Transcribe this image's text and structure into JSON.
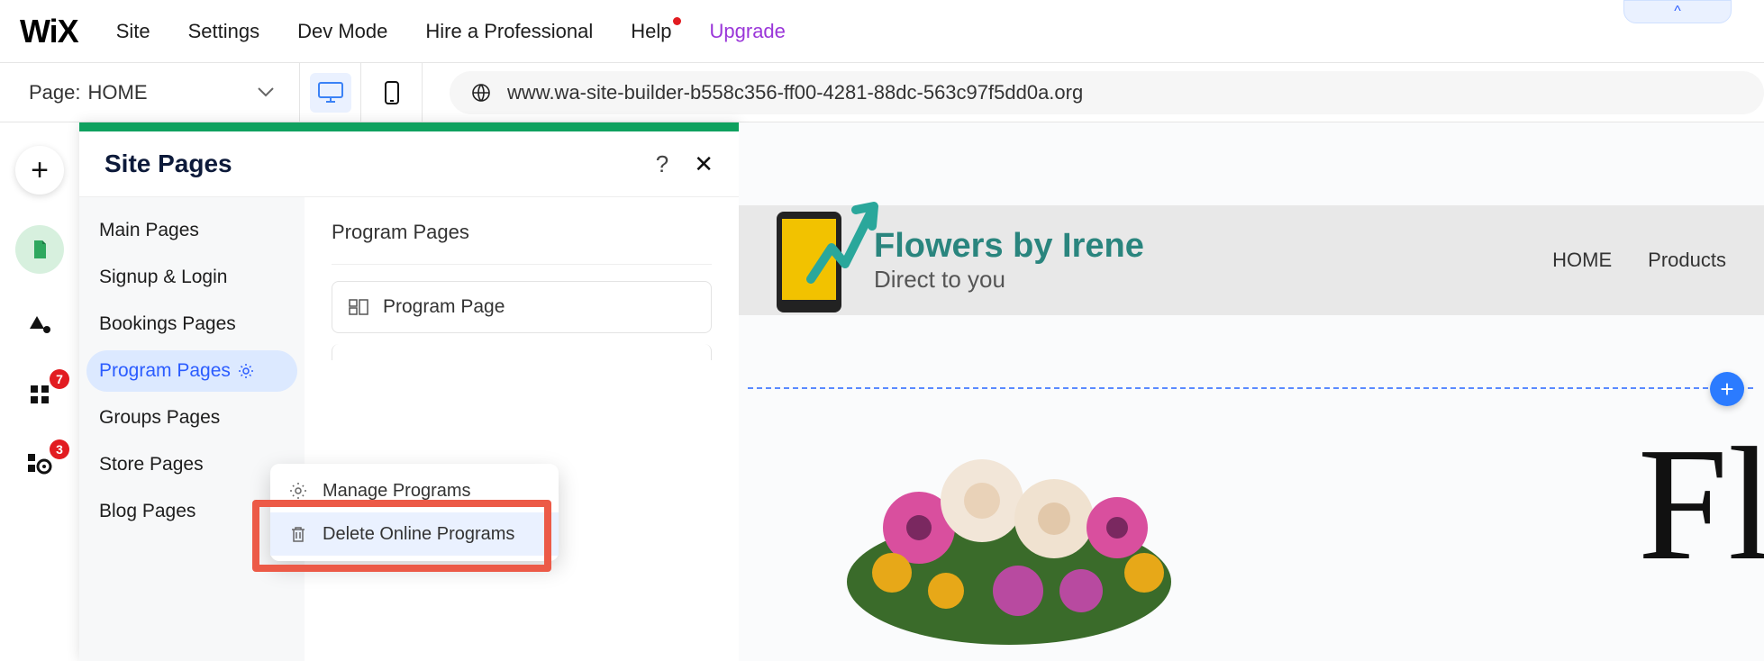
{
  "topMenu": {
    "site": "Site",
    "settings": "Settings",
    "devMode": "Dev Mode",
    "hire": "Hire a Professional",
    "help": "Help",
    "upgrade": "Upgrade"
  },
  "pageSelector": {
    "label": "Page:",
    "value": "HOME"
  },
  "url": "www.wa-site-builder-b558c356-ff00-4281-88dc-563c97f5dd0a.org",
  "collapseGlyph": "^",
  "leftTool": {
    "badge1": "7",
    "badge2": "3"
  },
  "panel": {
    "title": "Site Pages",
    "help": "?",
    "close": "✕",
    "categories": {
      "main": "Main Pages",
      "signup": "Signup & Login",
      "bookings": "Bookings Pages",
      "program": "Program Pages",
      "groups": "Groups Pages",
      "store": "Store Pages",
      "blog": "Blog Pages"
    },
    "detailTitle": "Program Pages",
    "pageCard": "Program Page"
  },
  "contextMenu": {
    "manage": "Manage Programs",
    "delete": "Delete Online Programs"
  },
  "canvas": {
    "siteTitle": "Flowers by Irene",
    "siteSub": "Direct to you",
    "nav": {
      "home": "HOME",
      "products": "Products"
    },
    "hero": "Fl",
    "plus": "+"
  }
}
